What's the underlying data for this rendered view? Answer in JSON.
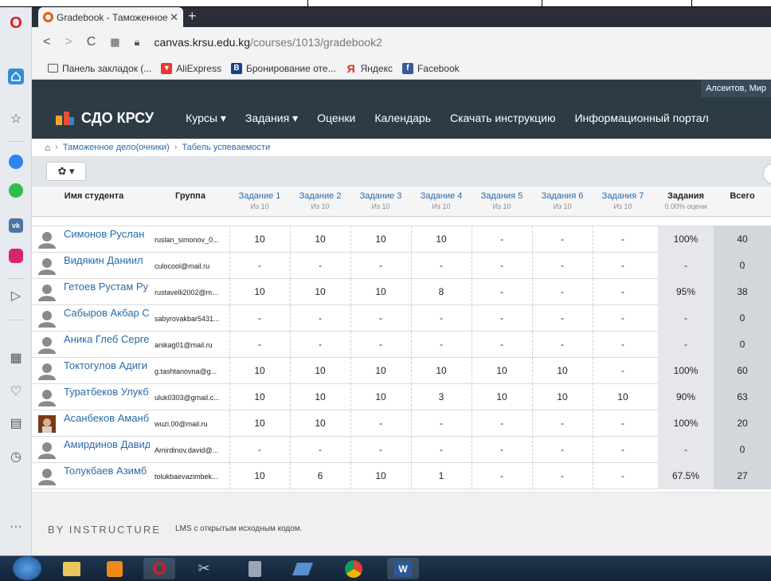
{
  "browser": {
    "tab_title": "Gradebook - Таможенное",
    "tab_close": "✕",
    "new_tab": "+",
    "url_host": "canvas.krsu.edu.kg",
    "url_path": "/courses/1013/gradebook2",
    "bookmarks": [
      {
        "label": "Панель закладок (...",
        "icon": "folder-icon",
        "color": "#555555"
      },
      {
        "label": "AliExpress",
        "icon": "aliexpress-icon",
        "color": "#e8392c"
      },
      {
        "label": "Бронирование оте...",
        "icon": "booking-icon",
        "color": "#1e3e84"
      },
      {
        "label": "Яндекс",
        "icon": "yandex-icon",
        "color": "#e52620"
      },
      {
        "label": "Facebook",
        "icon": "facebook-icon",
        "color": "#3b5998"
      }
    ]
  },
  "header": {
    "user": "Алсеитов, Мир",
    "logo": "СДО КРСУ",
    "nav": [
      "Курсы ▾",
      "Задания ▾",
      "Оценки",
      "Календарь",
      "Скачать инструкцию",
      "Информационный портал"
    ]
  },
  "breadcrumb": {
    "course": "Таможенное дело(очники)",
    "page": "Табель успеваемости"
  },
  "toolbar": {
    "gear_label": "✿ ▾"
  },
  "grid": {
    "headers": {
      "student": "Имя студента",
      "group": "Группа",
      "assignments": [
        {
          "name": "Задание 1",
          "out_of": "Из 10"
        },
        {
          "name": "Задание 2",
          "out_of": "Из 10"
        },
        {
          "name": "Задание 3",
          "out_of": "Из 10"
        },
        {
          "name": "Задание 4",
          "out_of": "Из 10"
        },
        {
          "name": "Задания 5",
          "out_of": "Из 10"
        },
        {
          "name": "Задания 6",
          "out_of": "Из 10"
        },
        {
          "name": "Задания 7",
          "out_of": "Из 10"
        }
      ],
      "group_total": "Задания",
      "group_total_sub": "0.00% оцени",
      "total": "Всего"
    },
    "rows": [
      {
        "name": "Симонов Руслан",
        "group": "ruslan_simonov_0...",
        "scores": [
          "10",
          "10",
          "10",
          "10",
          "-",
          "-",
          "-"
        ],
        "pct": "100%",
        "total": "40",
        "avatar": "default"
      },
      {
        "name": "Видякин Даниил",
        "group": "culocool@mail.ru",
        "scores": [
          "-",
          "-",
          "-",
          "-",
          "-",
          "-",
          "-"
        ],
        "pct": "-",
        "total": "0",
        "avatar": "default"
      },
      {
        "name": "Гетоев Рустам Ру",
        "group": "rustavelli2002@m...",
        "scores": [
          "10",
          "10",
          "10",
          "8",
          "-",
          "-",
          "-"
        ],
        "pct": "95%",
        "total": "38",
        "avatar": "default"
      },
      {
        "name": "Сабыров Акбар С",
        "group": "sabyrovakbar5431...",
        "scores": [
          "-",
          "-",
          "-",
          "-",
          "-",
          "-",
          "-"
        ],
        "pct": "-",
        "total": "0",
        "avatar": "default"
      },
      {
        "name": "Аника Глеб Серге",
        "group": "anikag01@mail.ru",
        "scores": [
          "-",
          "-",
          "-",
          "-",
          "-",
          "-",
          "-"
        ],
        "pct": "-",
        "total": "0",
        "avatar": "default"
      },
      {
        "name": "Токтогулов Адиги",
        "group": "g.tashtanovna@g...",
        "scores": [
          "10",
          "10",
          "10",
          "10",
          "10",
          "10",
          "-"
        ],
        "pct": "100%",
        "total": "60",
        "avatar": "default"
      },
      {
        "name": "Туратбеков Улукб",
        "group": "uluk0303@gmail.c...",
        "scores": [
          "10",
          "10",
          "10",
          "3",
          "10",
          "10",
          "10"
        ],
        "pct": "90%",
        "total": "63",
        "avatar": "default"
      },
      {
        "name": "Асанбеков Аманб",
        "group": "wuzi.00@mail.ru",
        "scores": [
          "10",
          "10",
          "-",
          "-",
          "-",
          "-",
          "-"
        ],
        "pct": "100%",
        "total": "20",
        "avatar": "photo"
      },
      {
        "name": "Амирдинов Давид",
        "group": "Amirdinov.david@...",
        "scores": [
          "-",
          "-",
          "-",
          "-",
          "-",
          "-",
          "-"
        ],
        "pct": "-",
        "total": "0",
        "avatar": "default"
      },
      {
        "name": "Толукбаев Азимб",
        "group": "tolukbaevazimbek...",
        "scores": [
          "10",
          "6",
          "10",
          "1",
          "-",
          "-",
          "-"
        ],
        "pct": "67.5%",
        "total": "27",
        "avatar": "default"
      }
    ]
  },
  "footer": {
    "brand": "BY INSTRUCTURE",
    "text": "LMS с открытым исходным кодом."
  },
  "colors": {
    "nav_bg": "#2d3b45",
    "link": "#2a6ba8"
  }
}
